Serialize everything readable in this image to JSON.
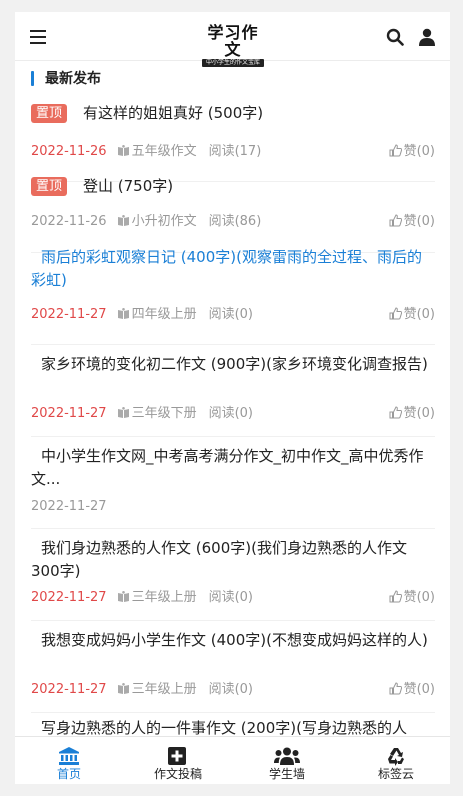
{
  "header": {
    "logo_main": "学习作文",
    "logo_sub": "中小学生的作文宝库",
    "menu_icon": "hamburger-icon",
    "search_icon": "search-icon",
    "user_icon": "user-icon"
  },
  "section": {
    "title": "最新发布"
  },
  "articles": [
    {
      "badge": "置顶",
      "title": "有这样的姐姐真好 (500字)",
      "date": "2022-11-26",
      "category": "五年级作文",
      "reads": "阅读(17)",
      "likes": "赞(0)"
    },
    {
      "badge": "置顶",
      "title": "登山 (750字)",
      "date": "2022-11-26",
      "category": "小升初作文",
      "reads": "阅读(86)",
      "likes": "赞(0)"
    },
    {
      "title": "雨后的彩虹观察日记 (400字)(观察雷雨的全过程、雨后的彩虹)",
      "date": "2022-11-27",
      "category": "四年级上册",
      "reads": "阅读(0)",
      "likes": "赞(0)"
    },
    {
      "title": "家乡环境的变化初二作文 (900字)(家乡环境变化调查报告)",
      "date": "2022-11-27",
      "category": "三年级下册",
      "reads": "阅读(0)",
      "likes": "赞(0)"
    },
    {
      "title": "中小学生作文网_中考高考满分作文_初中作文_高中优秀作文...",
      "date": "2022-11-27"
    },
    {
      "title": "我们身边熟悉的人作文 (600字)(我们身边熟悉的人作文300字)",
      "date": "2022-11-27",
      "category": "三年级上册",
      "reads": "阅读(0)",
      "likes": "赞(0)"
    },
    {
      "title": "我想变成妈妈小学生作文 (400字)(不想变成妈妈这样的人)",
      "date": "2022-11-27",
      "category": "三年级上册",
      "reads": "阅读(0)",
      "likes": "赞(0)"
    },
    {
      "title": "写身边熟悉的人的一件事作文 (200字)(写身边熟悉的人"
    }
  ],
  "nav": [
    {
      "label": "首页",
      "icon": "bank-icon",
      "active": true
    },
    {
      "label": "作文投稿",
      "icon": "plus-square-icon"
    },
    {
      "label": "学生墙",
      "icon": "users-icon"
    },
    {
      "label": "标签云",
      "icon": "recycle-icon"
    }
  ],
  "colors": {
    "accent": "#1a7fd6",
    "badge": "#e96c5d",
    "date_red": "#e04848",
    "meta": "#999999"
  }
}
